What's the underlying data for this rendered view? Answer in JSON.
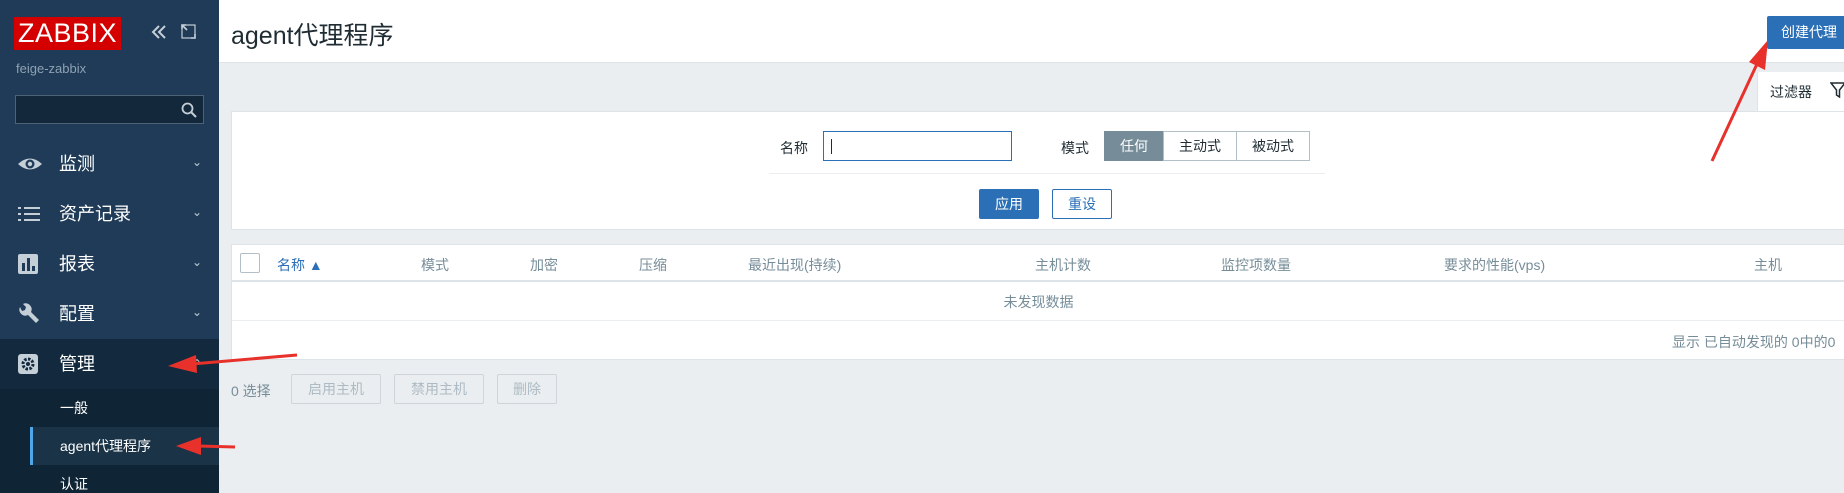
{
  "sidebar": {
    "logo": "ZABBIX",
    "collapse_icon": "double-chevron-left-icon",
    "kiosk_icon": "expand-icon",
    "server_name": "feige-zabbix",
    "search": {
      "value": "",
      "icon": "search-icon"
    },
    "menu": [
      {
        "label": "监测",
        "icon": "eye-icon"
      },
      {
        "label": "资产记录",
        "icon": "list-icon"
      },
      {
        "label": "报表",
        "icon": "bar-chart-icon"
      },
      {
        "label": "配置",
        "icon": "wrench-icon"
      },
      {
        "label": "管理",
        "icon": "gear-icon"
      }
    ],
    "submenu": [
      {
        "label": "一般"
      },
      {
        "label": "agent代理程序"
      },
      {
        "label": "认证"
      }
    ]
  },
  "header": {
    "title": "agent代理程序",
    "create_button": "创建代理"
  },
  "filter": {
    "tab_label": "过滤器",
    "tab_icon": "filter-icon",
    "name_label": "名称",
    "name_value": "",
    "mode_label": "模式",
    "mode_options": [
      "任何",
      "主动式",
      "被动式"
    ],
    "mode_selected": "任何",
    "apply": "应用",
    "reset": "重设"
  },
  "table": {
    "columns": [
      "名称 ▲",
      "模式",
      "加密",
      "压缩",
      "最近出现(持续)",
      "主机计数",
      "监控项数量",
      "要求的性能(vps)",
      "主机"
    ],
    "sorted_column": "名称",
    "no_data": "未发现数据",
    "footer": "显示 已自动发现的 0中的0"
  },
  "actions": {
    "selected": "0 选择",
    "enable_hosts": "启用主机",
    "disable_hosts": "禁用主机",
    "delete": "删除"
  },
  "colors": {
    "sidebar_bg": "#1f3b57",
    "accent": "#2b6fb6",
    "logo_red": "#d40000",
    "annotation_red": "#e8312a"
  }
}
